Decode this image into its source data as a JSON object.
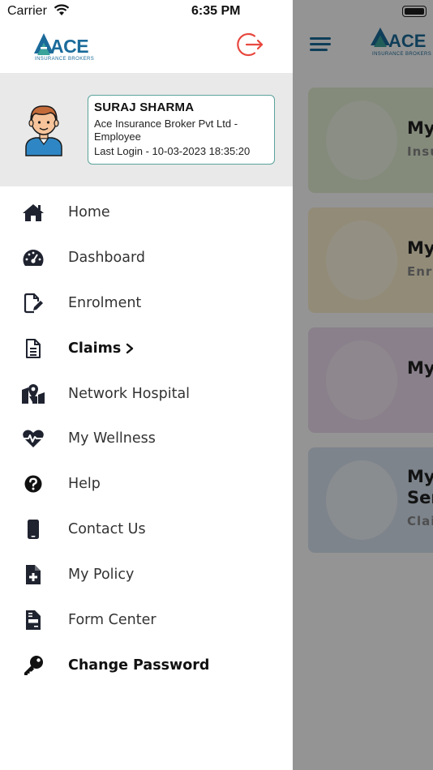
{
  "status_bar": {
    "carrier": "Carrier",
    "time": "6:35 PM"
  },
  "brand": {
    "logo_word": "ACE",
    "logo_tagline": "INSURANCE BROKERS"
  },
  "profile": {
    "name": "SURAJ SHARMA",
    "company": "Ace Insurance Broker Pvt Ltd - Employee",
    "last_login": "Last Login - 10-03-2023 18:35:20"
  },
  "menu": [
    {
      "label": "Home",
      "icon": "home-icon",
      "bold": false
    },
    {
      "label": "Dashboard",
      "icon": "gauge-icon",
      "bold": false
    },
    {
      "label": "Enrolment",
      "icon": "edit-file-icon",
      "bold": false
    },
    {
      "label": "Claims",
      "icon": "document-icon",
      "bold": true,
      "has_submenu": true
    },
    {
      "label": "Network Hospital",
      "icon": "map-pin-icon",
      "bold": false
    },
    {
      "label": "My Wellness",
      "icon": "heartbeat-icon",
      "bold": false
    },
    {
      "label": "Help",
      "icon": "question-icon",
      "bold": false
    },
    {
      "label": "Contact Us",
      "icon": "mobile-icon",
      "bold": false
    },
    {
      "label": "My Policy",
      "icon": "file-medical-icon",
      "bold": false
    },
    {
      "label": "Form Center",
      "icon": "file-invoice-icon",
      "bold": false
    },
    {
      "label": "Change Password",
      "icon": "key-icon",
      "bold": true
    }
  ],
  "background_cards": [
    {
      "title": "My",
      "subtitle": "Insu",
      "color": "#e3f0d4"
    },
    {
      "title": "My",
      "subtitle": "Enro",
      "color": "#fbf0cf"
    },
    {
      "title": "My",
      "subtitle": "",
      "color": "#ecdcef"
    },
    {
      "title": "My",
      "title_line2": "Ser",
      "subtitle": "Clai",
      "color": "#d7e4f2"
    }
  ],
  "colors": {
    "accent": "#1b6b9a",
    "logout": "#e8483f",
    "profile_border": "#5aa39b",
    "icon": "#1f2330"
  }
}
